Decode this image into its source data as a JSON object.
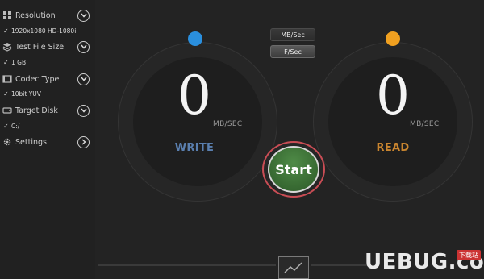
{
  "sidebar": {
    "items": [
      {
        "label": "Resolution",
        "icon": "resolution-icon",
        "value": "1920x1080 HD-1080i"
      },
      {
        "label": "Test File Size",
        "icon": "layers-icon",
        "value": "1 GB"
      },
      {
        "label": "Codec Type",
        "icon": "film-icon",
        "value": "10bit YUV"
      },
      {
        "label": "Target Disk",
        "icon": "disk-icon",
        "value": "C:/"
      },
      {
        "label": "Settings",
        "icon": "gear-icon"
      }
    ]
  },
  "units": {
    "mbsec": "MB/Sec",
    "fsec": "F/Sec",
    "selected": "F/Sec"
  },
  "write_gauge": {
    "value": "0",
    "unit": "MB/SEC",
    "title": "WRITE",
    "color": "#5a7faf",
    "dot_color": "#2a8fde"
  },
  "read_gauge": {
    "value": "0",
    "unit": "MB/SEC",
    "title": "READ",
    "color": "#c9852f",
    "dot_color": "#f0a020"
  },
  "start": {
    "label": "Start"
  },
  "watermark": {
    "brand": "UEBUG.com",
    "badge": "下载站"
  }
}
